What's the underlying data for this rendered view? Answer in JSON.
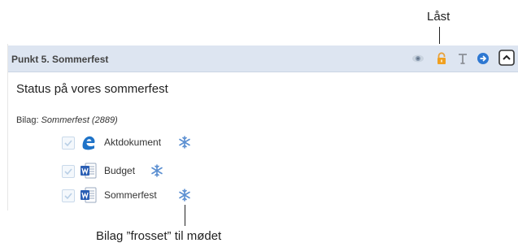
{
  "callouts": {
    "locked_label": "Låst",
    "frozen_label": "Bilag ”frosset” til mødet"
  },
  "agenda_item": {
    "title": "Punkt 5.  Sommerfest",
    "description": "Status på vores sommerfest",
    "attachments_prefix": "Bilag: ",
    "attachments_case": "Sommerfest (2889)"
  },
  "header_icons": [
    "eye-icon",
    "lock-icon",
    "text-font-icon",
    "arrow-right-circle-icon",
    "collapse-up-icon"
  ],
  "attachments": [
    {
      "name": "Aktdokument",
      "type": "edge-document",
      "checked": true,
      "frozen": true
    },
    {
      "name": "Budget",
      "type": "word-document",
      "checked": true,
      "frozen": true
    },
    {
      "name": "Sommerfest",
      "type": "word-document",
      "checked": true,
      "frozen": true
    }
  ],
  "colors": {
    "header_bg": "#dde5f1",
    "lock": "#f0a020",
    "snowflake": "#5b8fd1",
    "word_blue": "#2b5fb4"
  }
}
